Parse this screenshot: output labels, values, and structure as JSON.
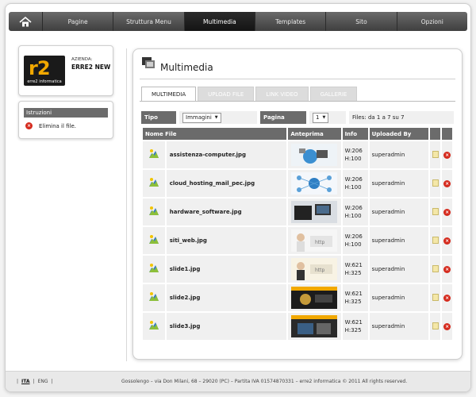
{
  "nav": {
    "home_icon": "home-icon",
    "items": [
      "Pagine",
      "Struttura Menu",
      "Multimedia",
      "Templates",
      "Sito",
      "Opzioni"
    ],
    "active": "Multimedia"
  },
  "company": {
    "logo_text": "r2",
    "logo_sub": "erre2 informatica",
    "label": "AZIENDA:",
    "name": "ERRE2 NEW"
  },
  "instructions": {
    "title": "Istruzioni",
    "delete_text": "Elimina il file."
  },
  "main": {
    "title": "Multimedia",
    "tabs": [
      "MULTIMEDIA",
      "UPLOAD FILE",
      "LINK VIDEO",
      "GALLERIE"
    ],
    "filter": {
      "type_label": "Tipo",
      "type_value": "Immagini",
      "page_label": "Pagina",
      "page_value": "1",
      "files_text": "Files: da 1 a 7 su 7"
    },
    "columns": [
      "Nome File",
      "Anteprima",
      "Info",
      "Uploaded By"
    ],
    "rows": [
      {
        "name": "assistenza-computer.jpg",
        "w": "W:206",
        "h": "H:100",
        "by": "superadmin"
      },
      {
        "name": "cloud_hosting_mail_pec.jpg",
        "w": "W:206",
        "h": "H:100",
        "by": "superadmin"
      },
      {
        "name": "hardware_software.jpg",
        "w": "W:206",
        "h": "H:100",
        "by": "superadmin"
      },
      {
        "name": "siti_web.jpg",
        "w": "W:206",
        "h": "H:100",
        "by": "superadmin"
      },
      {
        "name": "slide1.jpg",
        "w": "W:621",
        "h": "H:325",
        "by": "superadmin"
      },
      {
        "name": "slide2.jpg",
        "w": "W:621",
        "h": "H:325",
        "by": "superadmin"
      },
      {
        "name": "slide3.jpg",
        "w": "W:621",
        "h": "H:325",
        "by": "superadmin"
      }
    ]
  },
  "footer": {
    "lang_current": "ITA",
    "lang_other": "ENG",
    "copyright": "Gossolengo – via Don Milani, 68 – 29020 (PC) – Partita IVA 01574870331 – erre2 informatica © 2011 All rights reserved."
  },
  "colors": {
    "nav_dark": "#3f3f3f",
    "header_gray": "#6b6b6b",
    "cell_bg": "#f0f0f0",
    "logo_orange": "#f1a800",
    "delete_red": "#d52b1e"
  }
}
